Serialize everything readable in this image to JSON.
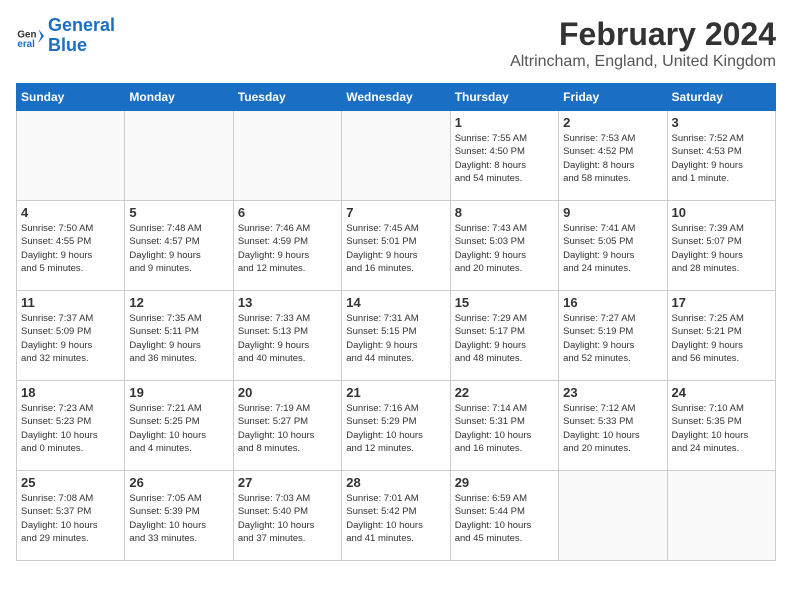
{
  "logo": {
    "line1": "General",
    "line2": "Blue"
  },
  "title": "February 2024",
  "subtitle": "Altrincham, England, United Kingdom",
  "headers": [
    "Sunday",
    "Monday",
    "Tuesday",
    "Wednesday",
    "Thursday",
    "Friday",
    "Saturday"
  ],
  "weeks": [
    [
      {
        "day": "",
        "info": ""
      },
      {
        "day": "",
        "info": ""
      },
      {
        "day": "",
        "info": ""
      },
      {
        "day": "",
        "info": ""
      },
      {
        "day": "1",
        "info": "Sunrise: 7:55 AM\nSunset: 4:50 PM\nDaylight: 8 hours\nand 54 minutes."
      },
      {
        "day": "2",
        "info": "Sunrise: 7:53 AM\nSunset: 4:52 PM\nDaylight: 8 hours\nand 58 minutes."
      },
      {
        "day": "3",
        "info": "Sunrise: 7:52 AM\nSunset: 4:53 PM\nDaylight: 9 hours\nand 1 minute."
      }
    ],
    [
      {
        "day": "4",
        "info": "Sunrise: 7:50 AM\nSunset: 4:55 PM\nDaylight: 9 hours\nand 5 minutes."
      },
      {
        "day": "5",
        "info": "Sunrise: 7:48 AM\nSunset: 4:57 PM\nDaylight: 9 hours\nand 9 minutes."
      },
      {
        "day": "6",
        "info": "Sunrise: 7:46 AM\nSunset: 4:59 PM\nDaylight: 9 hours\nand 12 minutes."
      },
      {
        "day": "7",
        "info": "Sunrise: 7:45 AM\nSunset: 5:01 PM\nDaylight: 9 hours\nand 16 minutes."
      },
      {
        "day": "8",
        "info": "Sunrise: 7:43 AM\nSunset: 5:03 PM\nDaylight: 9 hours\nand 20 minutes."
      },
      {
        "day": "9",
        "info": "Sunrise: 7:41 AM\nSunset: 5:05 PM\nDaylight: 9 hours\nand 24 minutes."
      },
      {
        "day": "10",
        "info": "Sunrise: 7:39 AM\nSunset: 5:07 PM\nDaylight: 9 hours\nand 28 minutes."
      }
    ],
    [
      {
        "day": "11",
        "info": "Sunrise: 7:37 AM\nSunset: 5:09 PM\nDaylight: 9 hours\nand 32 minutes."
      },
      {
        "day": "12",
        "info": "Sunrise: 7:35 AM\nSunset: 5:11 PM\nDaylight: 9 hours\nand 36 minutes."
      },
      {
        "day": "13",
        "info": "Sunrise: 7:33 AM\nSunset: 5:13 PM\nDaylight: 9 hours\nand 40 minutes."
      },
      {
        "day": "14",
        "info": "Sunrise: 7:31 AM\nSunset: 5:15 PM\nDaylight: 9 hours\nand 44 minutes."
      },
      {
        "day": "15",
        "info": "Sunrise: 7:29 AM\nSunset: 5:17 PM\nDaylight: 9 hours\nand 48 minutes."
      },
      {
        "day": "16",
        "info": "Sunrise: 7:27 AM\nSunset: 5:19 PM\nDaylight: 9 hours\nand 52 minutes."
      },
      {
        "day": "17",
        "info": "Sunrise: 7:25 AM\nSunset: 5:21 PM\nDaylight: 9 hours\nand 56 minutes."
      }
    ],
    [
      {
        "day": "18",
        "info": "Sunrise: 7:23 AM\nSunset: 5:23 PM\nDaylight: 10 hours\nand 0 minutes."
      },
      {
        "day": "19",
        "info": "Sunrise: 7:21 AM\nSunset: 5:25 PM\nDaylight: 10 hours\nand 4 minutes."
      },
      {
        "day": "20",
        "info": "Sunrise: 7:19 AM\nSunset: 5:27 PM\nDaylight: 10 hours\nand 8 minutes."
      },
      {
        "day": "21",
        "info": "Sunrise: 7:16 AM\nSunset: 5:29 PM\nDaylight: 10 hours\nand 12 minutes."
      },
      {
        "day": "22",
        "info": "Sunrise: 7:14 AM\nSunset: 5:31 PM\nDaylight: 10 hours\nand 16 minutes."
      },
      {
        "day": "23",
        "info": "Sunrise: 7:12 AM\nSunset: 5:33 PM\nDaylight: 10 hours\nand 20 minutes."
      },
      {
        "day": "24",
        "info": "Sunrise: 7:10 AM\nSunset: 5:35 PM\nDaylight: 10 hours\nand 24 minutes."
      }
    ],
    [
      {
        "day": "25",
        "info": "Sunrise: 7:08 AM\nSunset: 5:37 PM\nDaylight: 10 hours\nand 29 minutes."
      },
      {
        "day": "26",
        "info": "Sunrise: 7:05 AM\nSunset: 5:39 PM\nDaylight: 10 hours\nand 33 minutes."
      },
      {
        "day": "27",
        "info": "Sunrise: 7:03 AM\nSunset: 5:40 PM\nDaylight: 10 hours\nand 37 minutes."
      },
      {
        "day": "28",
        "info": "Sunrise: 7:01 AM\nSunset: 5:42 PM\nDaylight: 10 hours\nand 41 minutes."
      },
      {
        "day": "29",
        "info": "Sunrise: 6:59 AM\nSunset: 5:44 PM\nDaylight: 10 hours\nand 45 minutes."
      },
      {
        "day": "",
        "info": ""
      },
      {
        "day": "",
        "info": ""
      }
    ]
  ]
}
